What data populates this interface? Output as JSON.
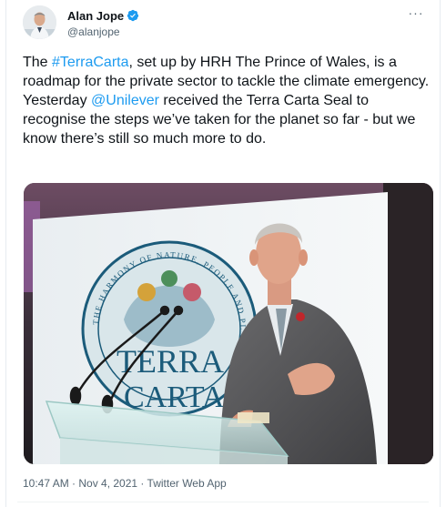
{
  "author": {
    "name": "Alan Jope",
    "handle": "@alanjope",
    "verified": true
  },
  "menu": {
    "more_label": "···"
  },
  "tweet": {
    "text_before_hashtag": "The ",
    "hashtag": "#TerraCarta",
    "text_middle": ", set up by HRH The Prince of Wales, is a roadmap for the private sector to tackle the climate emergency. Yesterday ",
    "mention": "@Unilever",
    "text_after_mention": " received the Terra Carta Seal to recognise the steps we’ve taken for the planet so far - but we know there’s still so much more to do."
  },
  "media": {
    "banner_arc_text": "THE HARMONY OF NATURE, PEOPLE AND PLANET",
    "banner_word_1": "TERRA",
    "banner_word_2": "CARTA"
  },
  "meta": {
    "timestamp": "10:47 AM · Nov 4, 2021 · Twitter Web App"
  },
  "colors": {
    "accent": "#1d9bf0",
    "text_primary": "#0f1419",
    "text_secondary": "#536471"
  }
}
